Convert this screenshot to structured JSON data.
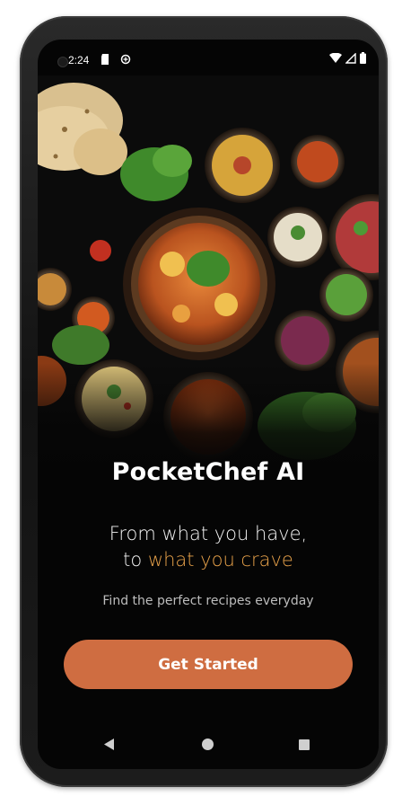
{
  "status_bar": {
    "time": "2:24",
    "left_icons": [
      "sd-card-icon",
      "data-saver-icon"
    ],
    "right_icons": [
      "wifi-icon",
      "signal-icon",
      "battery-icon"
    ]
  },
  "hero": {
    "image": "food-spread-illustration"
  },
  "app_title": "PocketChef AI",
  "tagline": {
    "line1": "From what you have,",
    "line2_prefix": "to ",
    "line2_accent": "what you crave"
  },
  "subtitle": "Find the perfect recipes everyday",
  "cta": {
    "label": "Get Started"
  },
  "colors": {
    "background": "#050505",
    "accent_text": "#e8a24a",
    "button": "#cf6d41"
  },
  "nav_bar": {
    "buttons": [
      "back-icon",
      "home-icon",
      "recents-icon"
    ]
  }
}
